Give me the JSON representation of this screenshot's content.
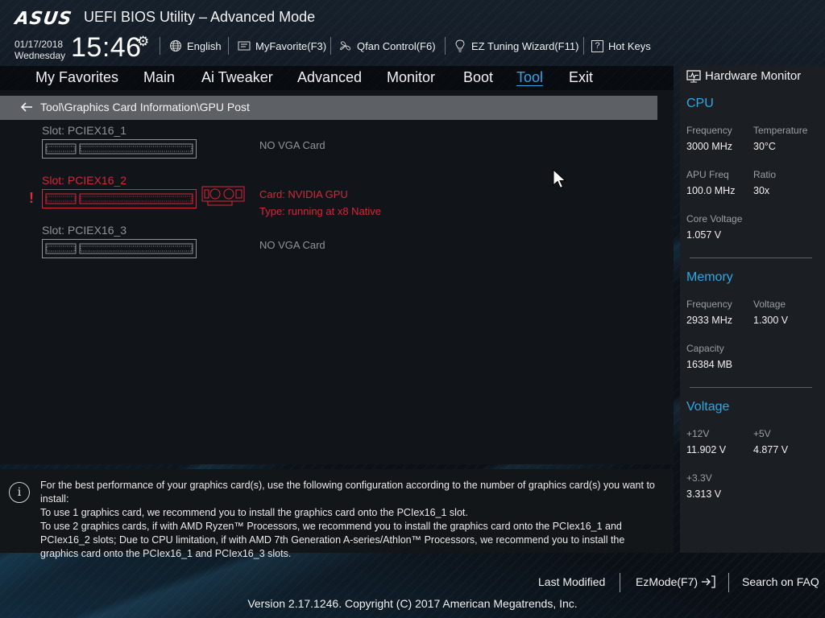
{
  "header": {
    "brand": "ASUS",
    "title": "UEFI BIOS Utility – Advanced Mode",
    "date": "01/17/2018",
    "weekday": "Wednesday",
    "time": "15:46",
    "items": [
      {
        "label": "English",
        "icon": "globe-icon"
      },
      {
        "label": "MyFavorite(F3)",
        "icon": "favorite-icon"
      },
      {
        "label": "Qfan Control(F6)",
        "icon": "fan-icon"
      },
      {
        "label": "EZ Tuning Wizard(F11)",
        "icon": "lightbulb-icon"
      },
      {
        "label": "Hot Keys",
        "icon": "help-icon"
      }
    ]
  },
  "nav": {
    "tabs": [
      "My Favorites",
      "Main",
      "Ai Tweaker",
      "Advanced",
      "Monitor",
      "Boot",
      "Tool",
      "Exit"
    ],
    "active": "Tool"
  },
  "main": {
    "breadcrumb": "Tool\\Graphics Card Information\\GPU Post",
    "slots": [
      {
        "label": "Slot: PCIEX16_1",
        "status": "NO VGA Card",
        "status2": ""
      },
      {
        "label": "Slot: PCIEX16_2",
        "status": "Card: NVIDIA GPU",
        "status2": "Type: running at x8 Native"
      },
      {
        "label": "Slot: PCIEX16_3",
        "status": "NO VGA Card",
        "status2": ""
      }
    ]
  },
  "info": {
    "line1": "For the best performance of your graphics card(s), use the following configuration according to the number of graphics card(s) you want to install:",
    "line2": "To use 1 graphics card, we recommend you to install the graphics card onto the PCIex16_1 slot.",
    "line3": "To use 2 graphics cards, if with AMD Ryzen™ Processors, we recommend you to install the graphics card onto the PCIex16_1 and PCIex16_2 slots; Due to CPU limitation, if with AMD 7th Generation A-series/Athlon™ Processors, we recommend you to install the graphics card onto the PCIex16_1 and PCIex16_3 slots."
  },
  "hw_monitor": {
    "title": "Hardware Monitor",
    "cpu": {
      "heading": "CPU",
      "frequency_label": "Frequency",
      "frequency": "3000 MHz",
      "temperature_label": "Temperature",
      "temperature": "30°C",
      "apu_freq_label": "APU Freq",
      "apu_freq": "100.0 MHz",
      "ratio_label": "Ratio",
      "ratio": "30x",
      "core_voltage_label": "Core Voltage",
      "core_voltage": "1.057 V"
    },
    "memory": {
      "heading": "Memory",
      "frequency_label": "Frequency",
      "frequency": "2933 MHz",
      "voltage_label": "Voltage",
      "voltage": "1.300 V",
      "capacity_label": "Capacity",
      "capacity": "16384 MB"
    },
    "voltage": {
      "heading": "Voltage",
      "v12_label": "+12V",
      "v12": "11.902 V",
      "v5_label": "+5V",
      "v5": "4.877 V",
      "v33_label": "+3.3V",
      "v33": "3.313 V"
    }
  },
  "footer": {
    "last_modified": "Last Modified",
    "ezmode": "EzMode(F7)",
    "search": "Search on FAQ",
    "copyright": "Version 2.17.1246. Copyright (C) 2017 American Megatrends, Inc."
  },
  "colors": {
    "accent": "#2fa8e6",
    "error": "#d5283a",
    "muted": "#8f949a"
  }
}
